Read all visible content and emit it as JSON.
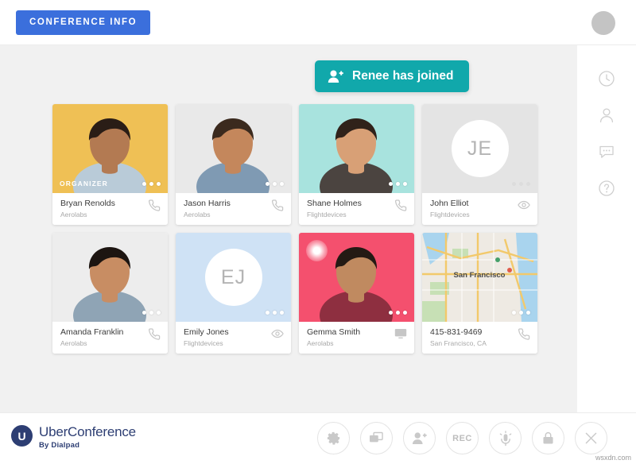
{
  "header": {
    "conference_info_label": "CONFERENCE INFO",
    "avatar": "user-avatar"
  },
  "notification": {
    "text": "Renee has joined",
    "icon": "person-add-icon",
    "color": "#11a8ab"
  },
  "sidebar": {
    "items": [
      {
        "name": "history",
        "icon": "clock-icon"
      },
      {
        "name": "participants",
        "icon": "person-icon"
      },
      {
        "name": "chat",
        "icon": "chat-bubble-icon"
      },
      {
        "name": "help",
        "icon": "question-circle-icon"
      }
    ]
  },
  "participants": [
    {
      "name": "Bryan Renolds",
      "org": "Aerolabs",
      "badge": "ORGANIZER",
      "status_icon": "phone-icon",
      "avatar_type": "photo",
      "bg": "#efc055",
      "speaking": false,
      "dots_dim": false
    },
    {
      "name": "Jason Harris",
      "org": "Aerolabs",
      "badge": "",
      "status_icon": "phone-icon",
      "avatar_type": "photo",
      "bg": "#e9e9e9",
      "speaking": false,
      "dots_dim": false
    },
    {
      "name": "Shane Holmes",
      "org": "Flightdevices",
      "badge": "",
      "status_icon": "phone-icon",
      "avatar_type": "photo",
      "bg": "#a8e3de",
      "speaking": false,
      "dots_dim": false
    },
    {
      "name": "John Elliot",
      "org": "Flightdevices",
      "badge": "",
      "status_icon": "eye-icon",
      "avatar_type": "initials",
      "initials": "JE",
      "bg": "#e4e4e4",
      "speaking": false,
      "dots_dim": true
    },
    {
      "name": "Amanda Franklin",
      "org": "Aerolabs",
      "badge": "",
      "status_icon": "phone-icon",
      "avatar_type": "photo",
      "bg": "#ededed",
      "speaking": false,
      "dots_dim": false
    },
    {
      "name": "Emily Jones",
      "org": "Flightdevices",
      "badge": "",
      "status_icon": "eye-icon",
      "avatar_type": "initials",
      "initials": "EJ",
      "bg": "#cfe2f5",
      "speaking": false,
      "dots_dim": false
    },
    {
      "name": "Gemma Smith",
      "org": "Aerolabs",
      "badge": "",
      "status_icon": "screen-icon",
      "avatar_type": "photo",
      "bg": "#f4506e",
      "speaking": true,
      "dots_dim": false
    },
    {
      "name": "415-831-9469",
      "org": "San Francisco, CA",
      "badge": "",
      "status_icon": "phone-icon",
      "avatar_type": "map",
      "map_label": "San Francisco",
      "bg": "#eae6df",
      "speaking": false,
      "dots_dim": false
    }
  ],
  "footer": {
    "brand_initial": "U",
    "brand_name": "UberConference",
    "brand_sub": "By Dialpad",
    "tools": [
      {
        "name": "settings",
        "icon": "gear-icon",
        "label": ""
      },
      {
        "name": "screen-share",
        "icon": "screen-share-icon",
        "label": ""
      },
      {
        "name": "add-participant",
        "icon": "person-add-icon",
        "label": ""
      },
      {
        "name": "record",
        "icon": "record-icon",
        "label": "REC"
      },
      {
        "name": "mute",
        "icon": "microphone-icon",
        "label": ""
      },
      {
        "name": "lock",
        "icon": "lock-icon",
        "label": ""
      },
      {
        "name": "end-call",
        "icon": "close-icon",
        "label": ""
      }
    ]
  },
  "watermark": "wsxdn.com"
}
